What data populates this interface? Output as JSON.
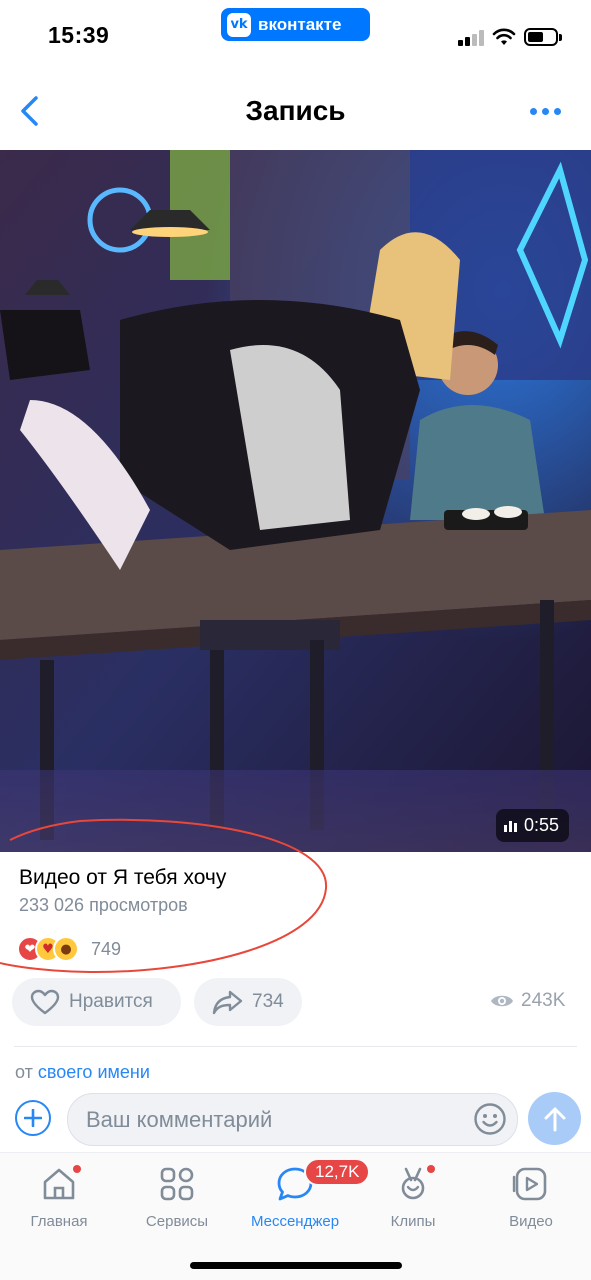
{
  "status_bar": {
    "time": "15:39",
    "app_pill": "вконтакте",
    "app_logo": "vk-logo"
  },
  "nav": {
    "title": "Запись",
    "back_icon": "chevron-left-icon",
    "more_icon": "more-horizontal-icon"
  },
  "video": {
    "duration": "0:55"
  },
  "post": {
    "title": "Видео от Я тебя хочу",
    "views": "233 026 просмотров",
    "reactions": [
      "heart-emoji",
      "heart-eyes-emoji",
      "surprised-emoji"
    ],
    "reactions_count": "749",
    "like_label": "Нравится",
    "share_count": "734",
    "views_count": "243K"
  },
  "comment": {
    "from_prefix": "от",
    "from_link": "своего имени",
    "placeholder": "Ваш комментарий"
  },
  "tabbar": {
    "tabs": [
      {
        "label": "Главная",
        "icon": "home-icon",
        "dot": true
      },
      {
        "label": "Сервисы",
        "icon": "services-icon",
        "dot": false
      },
      {
        "label": "Мессенджер",
        "icon": "messenger-icon",
        "badge": "12,7K",
        "active": true
      },
      {
        "label": "Клипы",
        "icon": "clips-icon",
        "dot": true
      },
      {
        "label": "Видео",
        "icon": "video-icon",
        "dot": false
      }
    ]
  },
  "colors": {
    "accent": "#2787f5",
    "vk_blue": "#0077ff",
    "secondary_text": "#818c99",
    "badge_red": "#e64646",
    "annotation_red": "#e8473a"
  }
}
